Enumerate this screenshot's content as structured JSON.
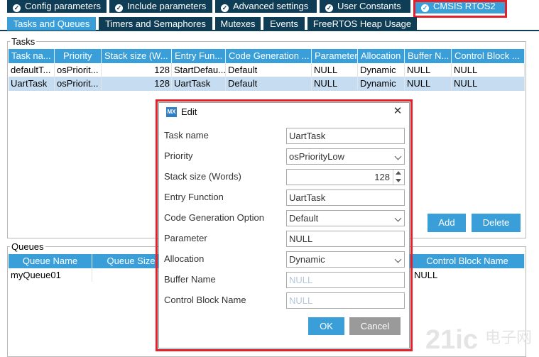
{
  "top_tabs": [
    {
      "label": "Config parameters"
    },
    {
      "label": "Include parameters"
    },
    {
      "label": "Advanced settings"
    },
    {
      "label": "User Constants"
    },
    {
      "label": "CMSIS RTOS2"
    }
  ],
  "sub_tabs": [
    {
      "label": "Tasks and Queues"
    },
    {
      "label": "Timers and Semaphores"
    },
    {
      "label": "Mutexes"
    },
    {
      "label": "Events"
    },
    {
      "label": "FreeRTOS Heap Usage"
    }
  ],
  "tasks": {
    "group_title": "Tasks",
    "headers": [
      "Task na...",
      "Priority",
      "Stack size (W...",
      "Entry Fun...",
      "Code Generation ...",
      "Parameter",
      "Allocation",
      "Buffer N...",
      "Control Block ..."
    ],
    "rows": [
      [
        "defaultT...",
        "osPriorit...",
        "128",
        "StartDefau...",
        "Default",
        "NULL",
        "Dynamic",
        "NULL",
        "NULL"
      ],
      [
        "UartTask",
        "osPriorit...",
        "128",
        "UartTask",
        "Default",
        "NULL",
        "Dynamic",
        "NULL",
        "NULL"
      ]
    ],
    "add_label": "Add",
    "delete_label": "Delete"
  },
  "queues": {
    "group_title": "Queues",
    "headers": [
      "Queue Name",
      "Queue Size",
      "Control Block Name"
    ],
    "rows": [
      [
        "myQueue01",
        "",
        "NULL"
      ]
    ]
  },
  "dialog": {
    "title": "Edit",
    "icon_text": "MX",
    "close": "✕",
    "labels": {
      "task_name": "Task name",
      "priority": "Priority",
      "stack_size": "Stack size (Words)",
      "entry_function": "Entry Function",
      "code_gen": "Code Generation Option",
      "parameter": "Parameter",
      "allocation": "Allocation",
      "buffer_name": "Buffer Name",
      "control_block": "Control Block Name"
    },
    "values": {
      "task_name": "UartTask",
      "priority": "osPriorityLow",
      "stack_size": "128",
      "entry_function": "UartTask",
      "code_gen": "Default",
      "parameter": "NULL",
      "allocation": "Dynamic",
      "buffer_name": "NULL",
      "control_block": "NULL"
    },
    "ok_label": "OK",
    "cancel_label": "Cancel"
  },
  "watermark": {
    "big": "21ic",
    "cn": "电子网"
  },
  "colors": {
    "tab_dark": "#0f3d55",
    "accent": "#3a9fd8",
    "highlight": "#e3202a",
    "selection": "#c5dcf1"
  }
}
